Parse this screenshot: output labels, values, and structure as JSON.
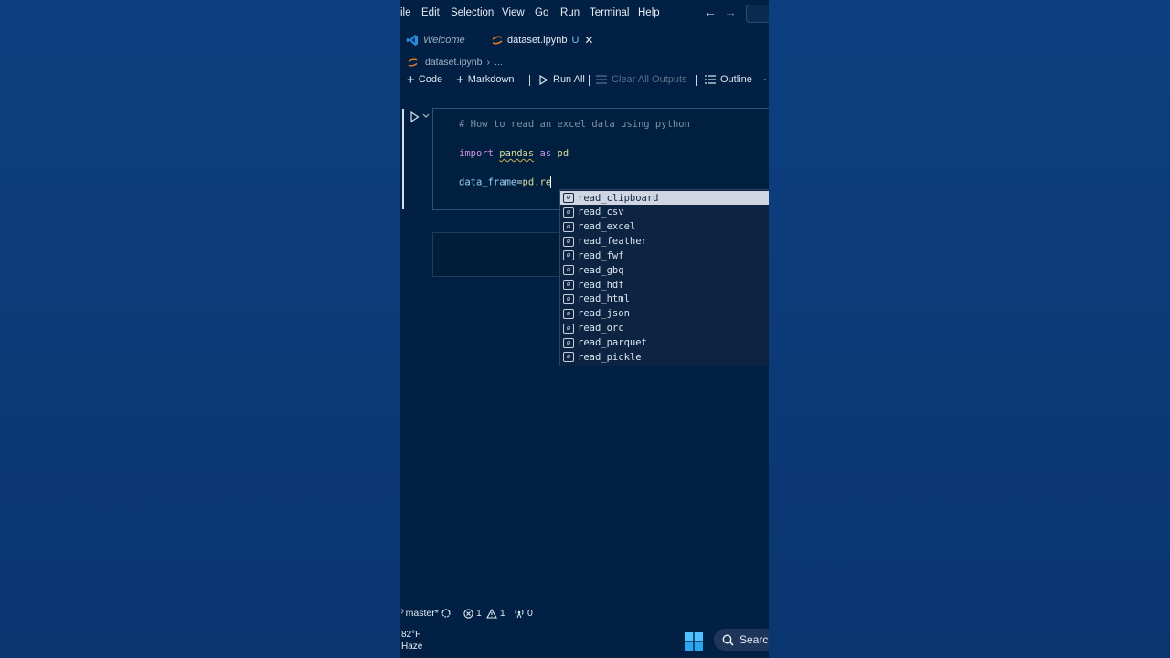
{
  "menubar": {
    "items": [
      "ile",
      "Edit",
      "Selection",
      "View",
      "Go",
      "Run",
      "Terminal",
      "Help"
    ],
    "back_icon": "arrow-left-icon",
    "forward_icon": "arrow-right-icon"
  },
  "tabs": [
    {
      "label": "Welcome",
      "icon": "vscode-logo-icon"
    },
    {
      "label": "dataset.ipynb",
      "icon": "notebook-icon",
      "status": "U",
      "close": "✕"
    }
  ],
  "breadcrumb": {
    "file": "dataset.ipynb",
    "separator": "›",
    "more": "..."
  },
  "notebook_toolbar": {
    "code": "Code",
    "markdown": "Markdown",
    "run_all": "Run All",
    "clear_all_outputs": "Clear All Outputs",
    "outline": "Outline"
  },
  "cell": {
    "comment": "# How to read an excel data using python",
    "import_kw": "import",
    "import_module": "pandas",
    "as_kw": "as",
    "alias": "pd",
    "assign_var": "data_frame",
    "assign_op": "=",
    "assign_expr": "pd.re"
  },
  "suggestions": {
    "icon": "symbol-variable-icon",
    "active_index": 0,
    "items": [
      "read_clipboard",
      "read_csv",
      "read_excel",
      "read_feather",
      "read_fwf",
      "read_gbq",
      "read_hdf",
      "read_html",
      "read_json",
      "read_orc",
      "read_parquet",
      "read_pickle"
    ]
  },
  "statusbar": {
    "branch": "master*",
    "errors": "1",
    "warnings": "1",
    "ports": "0"
  },
  "taskbar": {
    "temperature": "82°F",
    "condition": "Haze",
    "search": "Search"
  },
  "colors": {
    "editor_bg": "#012043",
    "page_bg": "#0b3b78",
    "keyword": "#d190e4",
    "module": "#d7dd9c",
    "variable": "#9cd3f5"
  }
}
